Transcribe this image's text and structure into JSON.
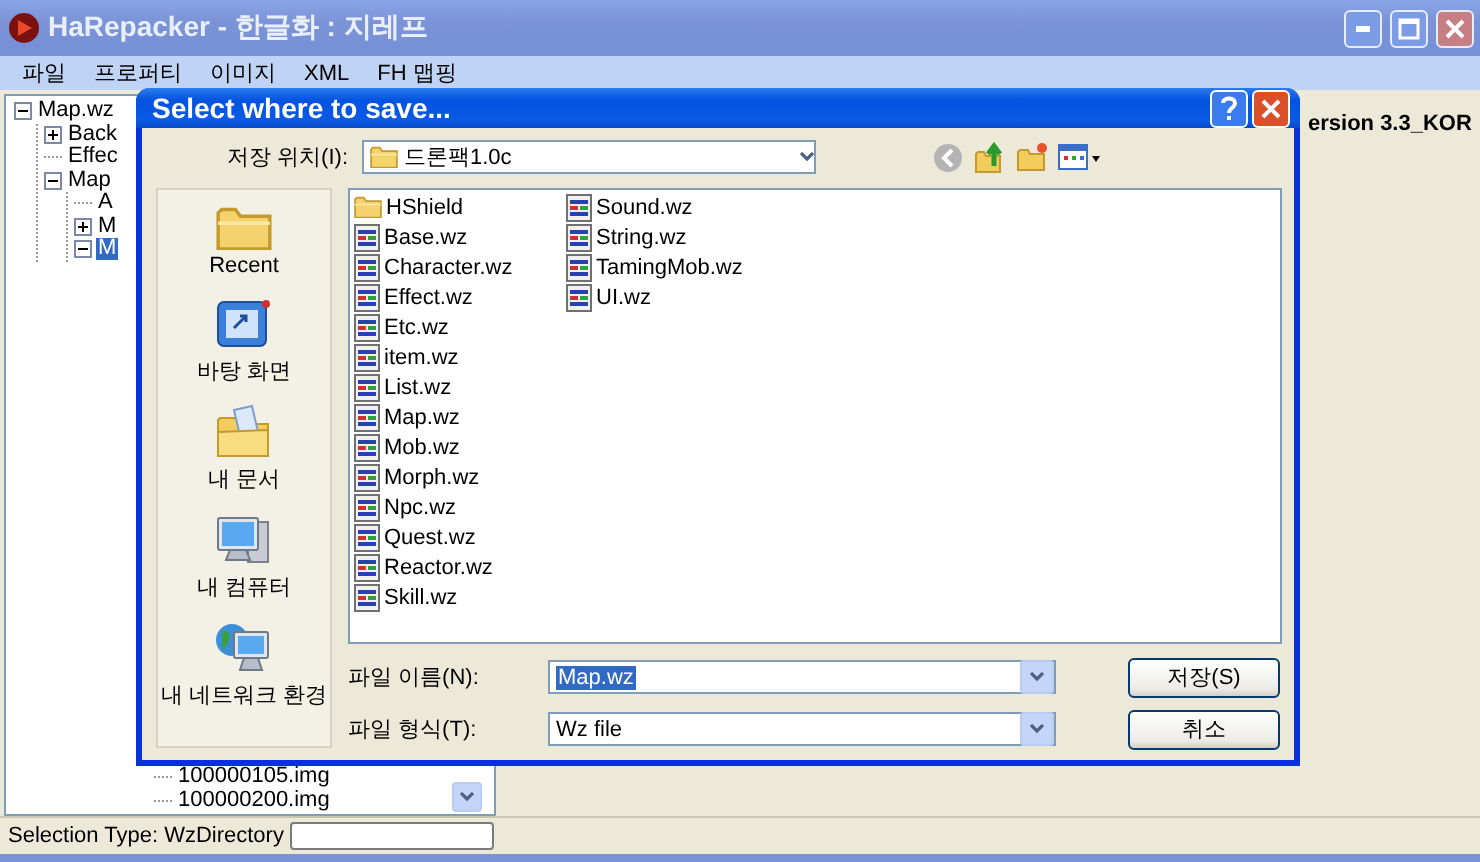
{
  "window": {
    "title": "HaRepacker - 한글화 : 지레프"
  },
  "menu": [
    {
      "label": "파일"
    },
    {
      "label": "프로퍼티"
    },
    {
      "label": "이미지"
    },
    {
      "label": "XML"
    },
    {
      "label": "FH 맵핑"
    }
  ],
  "tree": {
    "items": [
      {
        "label": "Map.wz",
        "expanded": true,
        "selected": false,
        "children": [
          {
            "label": "Back",
            "expanded": false,
            "selected": false
          },
          {
            "label": "Effec",
            "selected": false
          },
          {
            "label": "Map",
            "expanded": true,
            "selected": false,
            "children": [
              {
                "label": "A",
                "selected": false
              },
              {
                "label": "M",
                "expanded": false,
                "selected": false
              },
              {
                "label": "M",
                "expanded": true,
                "selected": true
              }
            ]
          }
        ]
      }
    ],
    "lower_items": [
      {
        "label": "100000105.img",
        "selected": false
      },
      {
        "label": "100000200.img",
        "selected": false
      }
    ]
  },
  "version_label": "ersion 3.3_KOR",
  "status_bar": {
    "text": "Selection Type: WzDirectory"
  },
  "dialog": {
    "title": "Select where to save...",
    "location_label": "저장 위치(I):",
    "location": "드론팩1.0c",
    "places": [
      {
        "label": "Recent",
        "kind": "recent"
      },
      {
        "label": "바탕 화면",
        "kind": "desktop"
      },
      {
        "label": "내 문서",
        "kind": "documents"
      },
      {
        "label": "내 컴퓨터",
        "kind": "computer"
      },
      {
        "label": "내 네트워크 환경",
        "kind": "network"
      }
    ],
    "files": [
      {
        "name": "HShield",
        "kind": "folder"
      },
      {
        "name": "Base.wz",
        "kind": "file"
      },
      {
        "name": "Character.wz",
        "kind": "file"
      },
      {
        "name": "Effect.wz",
        "kind": "file"
      },
      {
        "name": "Etc.wz",
        "kind": "file"
      },
      {
        "name": "item.wz",
        "kind": "file"
      },
      {
        "name": "List.wz",
        "kind": "file"
      },
      {
        "name": "Map.wz",
        "kind": "file"
      },
      {
        "name": "Mob.wz",
        "kind": "file"
      },
      {
        "name": "Morph.wz",
        "kind": "file"
      },
      {
        "name": "Npc.wz",
        "kind": "file"
      },
      {
        "name": "Quest.wz",
        "kind": "file"
      },
      {
        "name": "Reactor.wz",
        "kind": "file"
      },
      {
        "name": "Skill.wz",
        "kind": "file"
      },
      {
        "name": "Sound.wz",
        "kind": "file"
      },
      {
        "name": "String.wz",
        "kind": "file"
      },
      {
        "name": "TamingMob.wz",
        "kind": "file"
      },
      {
        "name": "UI.wz",
        "kind": "file"
      }
    ],
    "file_name_label": "파일 이름(N):",
    "file_name": "Map.wz",
    "file_type_label": "파일 형식(T):",
    "file_type": "Wz file",
    "buttons": [
      "저장(S)",
      "취소"
    ]
  }
}
